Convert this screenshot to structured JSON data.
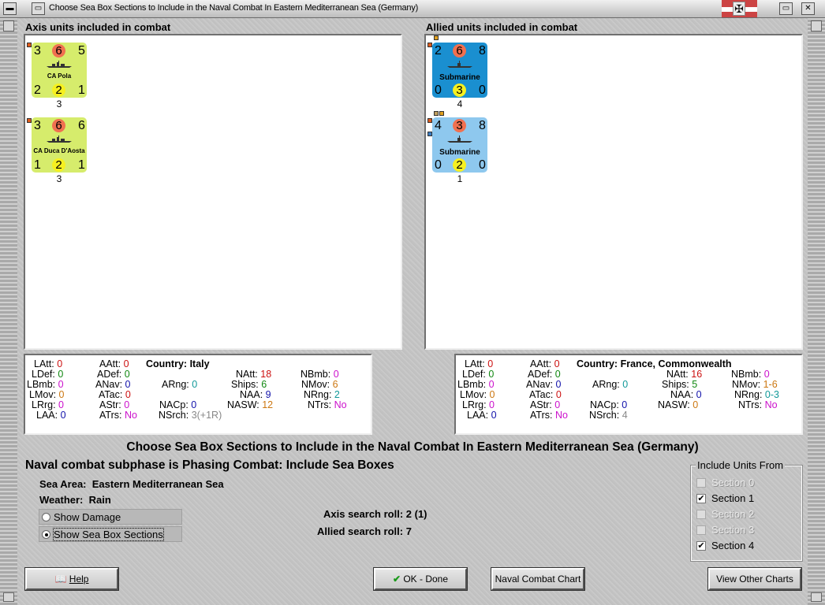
{
  "window": {
    "title": "Choose Sea Box Sections to Include in the Naval Combat In Eastern Mediterranean Sea (Germany)"
  },
  "axis": {
    "heading": "Axis units included in combat",
    "units": [
      {
        "tl": "3",
        "tc": "6",
        "tr": "5",
        "name": "CA Pola",
        "bl": "2",
        "bc": "2",
        "br": "1",
        "count": "3"
      },
      {
        "tl": "3",
        "tc": "6",
        "tr": "6",
        "name": "CA Duca D'Aosta",
        "bl": "1",
        "bc": "2",
        "br": "1",
        "count": "3"
      }
    ]
  },
  "allied": {
    "heading": "Allied units included in combat",
    "units": [
      {
        "tl": "2",
        "tc": "6",
        "tr": "8",
        "name": "Submarine",
        "bl": "0",
        "bc": "3",
        "br": "0",
        "count": "4"
      },
      {
        "tl": "4",
        "tc": "3",
        "tr": "8",
        "name": "Submarine",
        "bl": "0",
        "bc": "2",
        "br": "0",
        "count": "1"
      }
    ]
  },
  "axis_stats": {
    "country_label": "Country:",
    "country": "Italy",
    "LAtt": "0",
    "LDef": "0",
    "LBmb": "0",
    "LMov": "0",
    "LRrg": "0",
    "LAA": "0",
    "AAtt": "0",
    "ADef": "0",
    "ANav": "0",
    "ATac": "0",
    "AStr": "0",
    "ATrs": "No",
    "ARng": "0",
    "NAtt": "18",
    "Ships": "6",
    "NAA": "9",
    "NASW": "12",
    "NACp": "0",
    "NSrch": "3(+1R)",
    "NBmb": "0",
    "NMov": "6",
    "NRng": "2",
    "NTrs": "No"
  },
  "allied_stats": {
    "country_label": "Country:",
    "country": "France, Commonwealth",
    "LAtt": "0",
    "LDef": "0",
    "LBmb": "0",
    "LMov": "0",
    "LRrg": "0",
    "LAA": "0",
    "AAtt": "0",
    "ADef": "0",
    "ANav": "0",
    "ATac": "0",
    "AStr": "0",
    "ATrs": "No",
    "ARng": "0",
    "NAtt": "16",
    "Ships": "5",
    "NAA": "0",
    "NASW": "0",
    "NACp": "0",
    "NSrch": "4",
    "NBmb": "0",
    "NMov": "1-6",
    "NRng": "0-3",
    "NTrs": "No"
  },
  "main": {
    "title": "Choose Sea Box Sections to Include in the Naval Combat In Eastern Mediterranean Sea (Germany)",
    "subphase": "Naval combat subphase is Phasing Combat: Include Sea Boxes",
    "sea_area_label": "Sea Area:",
    "sea_area": "Eastern Mediterranean Sea",
    "weather_label": "Weather:",
    "weather": "Rain",
    "show_damage": "Show Damage",
    "show_sections": "Show Sea Box Sections",
    "axis_roll": "Axis search roll: 2 (1)",
    "allied_roll": "Allied search roll: 7"
  },
  "include": {
    "title": "Include Units From",
    "sections": [
      {
        "label": "Section 0",
        "checked": false,
        "enabled": false
      },
      {
        "label": "Section 1",
        "checked": true,
        "enabled": true
      },
      {
        "label": "Section 2",
        "checked": false,
        "enabled": false
      },
      {
        "label": "Section 3",
        "checked": false,
        "enabled": false
      },
      {
        "label": "Section 4",
        "checked": true,
        "enabled": true
      }
    ]
  },
  "buttons": {
    "help": "Help",
    "ok": "OK - Done",
    "naval_chart": "Naval Combat Chart",
    "other_charts": "View Other Charts"
  },
  "colors": {
    "axis_counter": "#d6ec6c",
    "allied_counter_dark": "#1a8fd0",
    "allied_counter_light": "#8ec8ee",
    "red_circle": "#f07050",
    "yellow_circle": "#f6f020"
  }
}
